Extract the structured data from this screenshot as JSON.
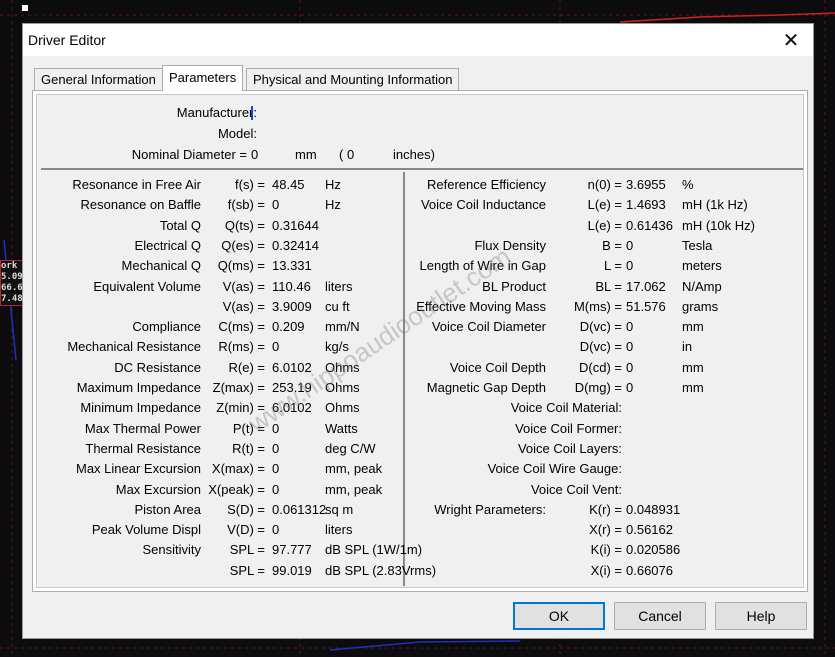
{
  "window": {
    "title": "Driver Editor"
  },
  "tabs": [
    "General Information",
    "Parameters",
    "Physical and Mounting Information"
  ],
  "top": {
    "manufacturer": "Manufacturer:",
    "model": "Model:",
    "nominal": "Nominal Diameter =",
    "nom_val": "0",
    "mm": "mm",
    "paren": "( 0",
    "inches": "inches)"
  },
  "left_rows": [
    [
      "Resonance in Free Air",
      "f(s) =",
      "48.45",
      "Hz"
    ],
    [
      "Resonance on Baffle",
      "f(sb) =",
      "0",
      "Hz"
    ],
    [
      "Total Q",
      "Q(ts) =",
      "0.31644",
      ""
    ],
    [
      "Electrical Q",
      "Q(es) =",
      "0.32414",
      ""
    ],
    [
      "Mechanical Q",
      "Q(ms) =",
      "13.331",
      ""
    ],
    [
      "Equivalent Volume",
      "V(as) =",
      "110.46",
      "liters"
    ],
    [
      "",
      "V(as) =",
      "3.9009",
      "cu ft"
    ],
    [
      "Compliance",
      "C(ms) =",
      "0.209",
      "mm/N"
    ],
    [
      "Mechanical Resistance",
      "R(ms) =",
      "0",
      "kg/s"
    ],
    [
      "DC Resistance",
      "R(e) =",
      "6.0102",
      "Ohms"
    ],
    [
      "Maximum Impedance",
      "Z(max) =",
      "253.19",
      "Ohms"
    ],
    [
      "Minimum Impedance",
      "Z(min) =",
      "6.0102",
      "Ohms"
    ],
    [
      "Max Thermal Power",
      "P(t) =",
      "0",
      "Watts"
    ],
    [
      "Thermal Resistance",
      "R(t) =",
      "0",
      "deg C/W"
    ],
    [
      "Max Linear Excursion",
      "X(max) =",
      "0",
      "mm, peak"
    ],
    [
      "Max Excursion",
      "X(peak) =",
      "0",
      "mm, peak"
    ],
    [
      "Piston Area",
      "S(D) =",
      "0.061312",
      "sq m"
    ],
    [
      "Peak Volume Displ",
      "V(D) =",
      "0",
      "liters"
    ],
    [
      "Sensitivity",
      "SPL =",
      "97.777",
      "dB SPL (1W/1m)"
    ],
    [
      "",
      "SPL =",
      "99.019",
      "dB SPL (2.83Vrms)"
    ]
  ],
  "right_rows": [
    [
      "Reference Efficiency",
      "n(0) =",
      "3.6955",
      "%"
    ],
    [
      "Voice Coil Inductance",
      "L(e) =",
      "1.4693",
      "mH (1k Hz)"
    ],
    [
      "",
      "L(e) =",
      "0.61436",
      "mH (10k Hz)"
    ],
    [
      "Flux Density",
      "B =",
      "0",
      "Tesla"
    ],
    [
      "Length of Wire in Gap",
      "L =",
      "0",
      "meters"
    ],
    [
      "BL Product",
      "BL =",
      "17.062",
      "N/Amp"
    ],
    [
      "Effective Moving Mass",
      "M(ms) =",
      "51.576",
      "grams"
    ],
    [
      "Voice Coil Diameter",
      "D(vc) =",
      "0",
      "mm"
    ],
    [
      "",
      "D(vc) =",
      "0",
      "in"
    ],
    [
      "Voice Coil Depth",
      "D(cd) =",
      "0",
      "mm"
    ],
    [
      "Magnetic Gap Depth",
      "D(mg) =",
      "0",
      "mm"
    ],
    [
      "",
      "Voice Coil Material:",
      "",
      ""
    ],
    [
      "",
      "Voice Coil Former:",
      "",
      ""
    ],
    [
      "",
      "Voice Coil Layers:",
      "",
      ""
    ],
    [
      "",
      "Voice Coil Wire Gauge:",
      "",
      ""
    ],
    [
      "",
      "Voice Coil Vent:",
      "",
      ""
    ],
    [
      "Wright Parameters:",
      "K(r) =",
      "0.048931",
      ""
    ],
    [
      "",
      "X(r) =",
      "0.56162",
      ""
    ],
    [
      "",
      "K(i) =",
      "0.020586",
      ""
    ],
    [
      "",
      "X(i) =",
      "0.66076",
      ""
    ]
  ],
  "buttons": {
    "ok": "OK",
    "cancel": "Cancel",
    "help": "Help"
  },
  "watermark": "www.hippoaudiooutlet.com",
  "bg_label": [
    "ork",
    "5.09",
    "66.6",
    "7.48"
  ]
}
